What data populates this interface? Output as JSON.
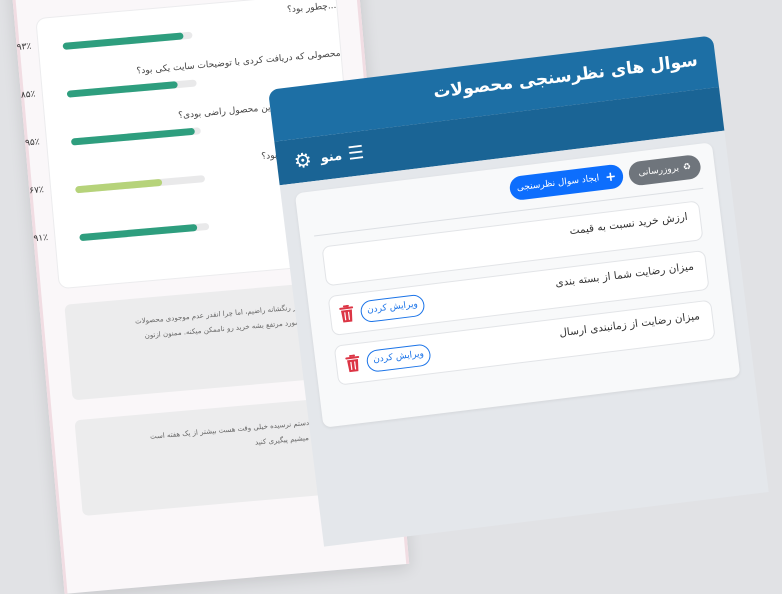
{
  "back_panel": {
    "results": [
      {
        "question": "...چطور بود؟",
        "percent": "۹۳٪",
        "value": 0.93
      },
      {
        "question": "محصولی که دریافت کردی با توضیحات سایت یکی بود؟",
        "percent": "۸۵٪",
        "value": 0.85
      },
      {
        "question": "از انتخابت در خرید این محصول راضی بودی؟",
        "percent": "۹۵٪",
        "value": 0.95
      },
      {
        "question": "...سفارشت چطور بود؟",
        "percent": "۶۷٪",
        "value": 0.67
      },
      {
        "question": "...دانه خرید کنی؟",
        "percent": "۹۱٪",
        "value": 0.91
      }
    ],
    "comments": [
      {
        "line1": "...م از رنگشانه راضیم، اما چرا انقدر عدم موجودی محصولات",
        "line2": "...ن مورد مرتفع بشه خرید رو ناممکن میکنه. ممنون ازتون"
      },
      {
        "line1": "...ه دستم نرسیده خیلی وقت هست بیشتر از یک هفته است",
        "line2": "...ن میشیم پیگیری کنید"
      }
    ],
    "colors": {
      "bar_fill": "#2e9e7e",
      "bar_fill_mid": "#b6d37a"
    }
  },
  "front_panel": {
    "title": "سوال های نظرسنجی محصولات",
    "toolbar": {
      "menu_label": "منو",
      "menu_icon": "hamburger-icon",
      "settings_icon": "gear-icon"
    },
    "actions": {
      "refresh_label": "بروزرسانی",
      "refresh_icon": "recycle-icon",
      "create_label": "ایجاد سوال نظرسنجی",
      "create_icon": "plus-icon"
    },
    "questions": [
      {
        "text": "ارزش خرید نسبت به قیمت",
        "editable": false
      },
      {
        "text": "میزان رضایت شما از بسته بندی",
        "editable": true,
        "edit_label": "ویرایش کردن"
      },
      {
        "text": "میزان رضایت از زمانبندی ارسال",
        "editable": true,
        "edit_label": "ویرایش کردن"
      }
    ],
    "colors": {
      "header": "#1d6fa5",
      "primary": "#0d6efd",
      "secondary": "#6f757c",
      "danger": "#dc3545"
    }
  }
}
